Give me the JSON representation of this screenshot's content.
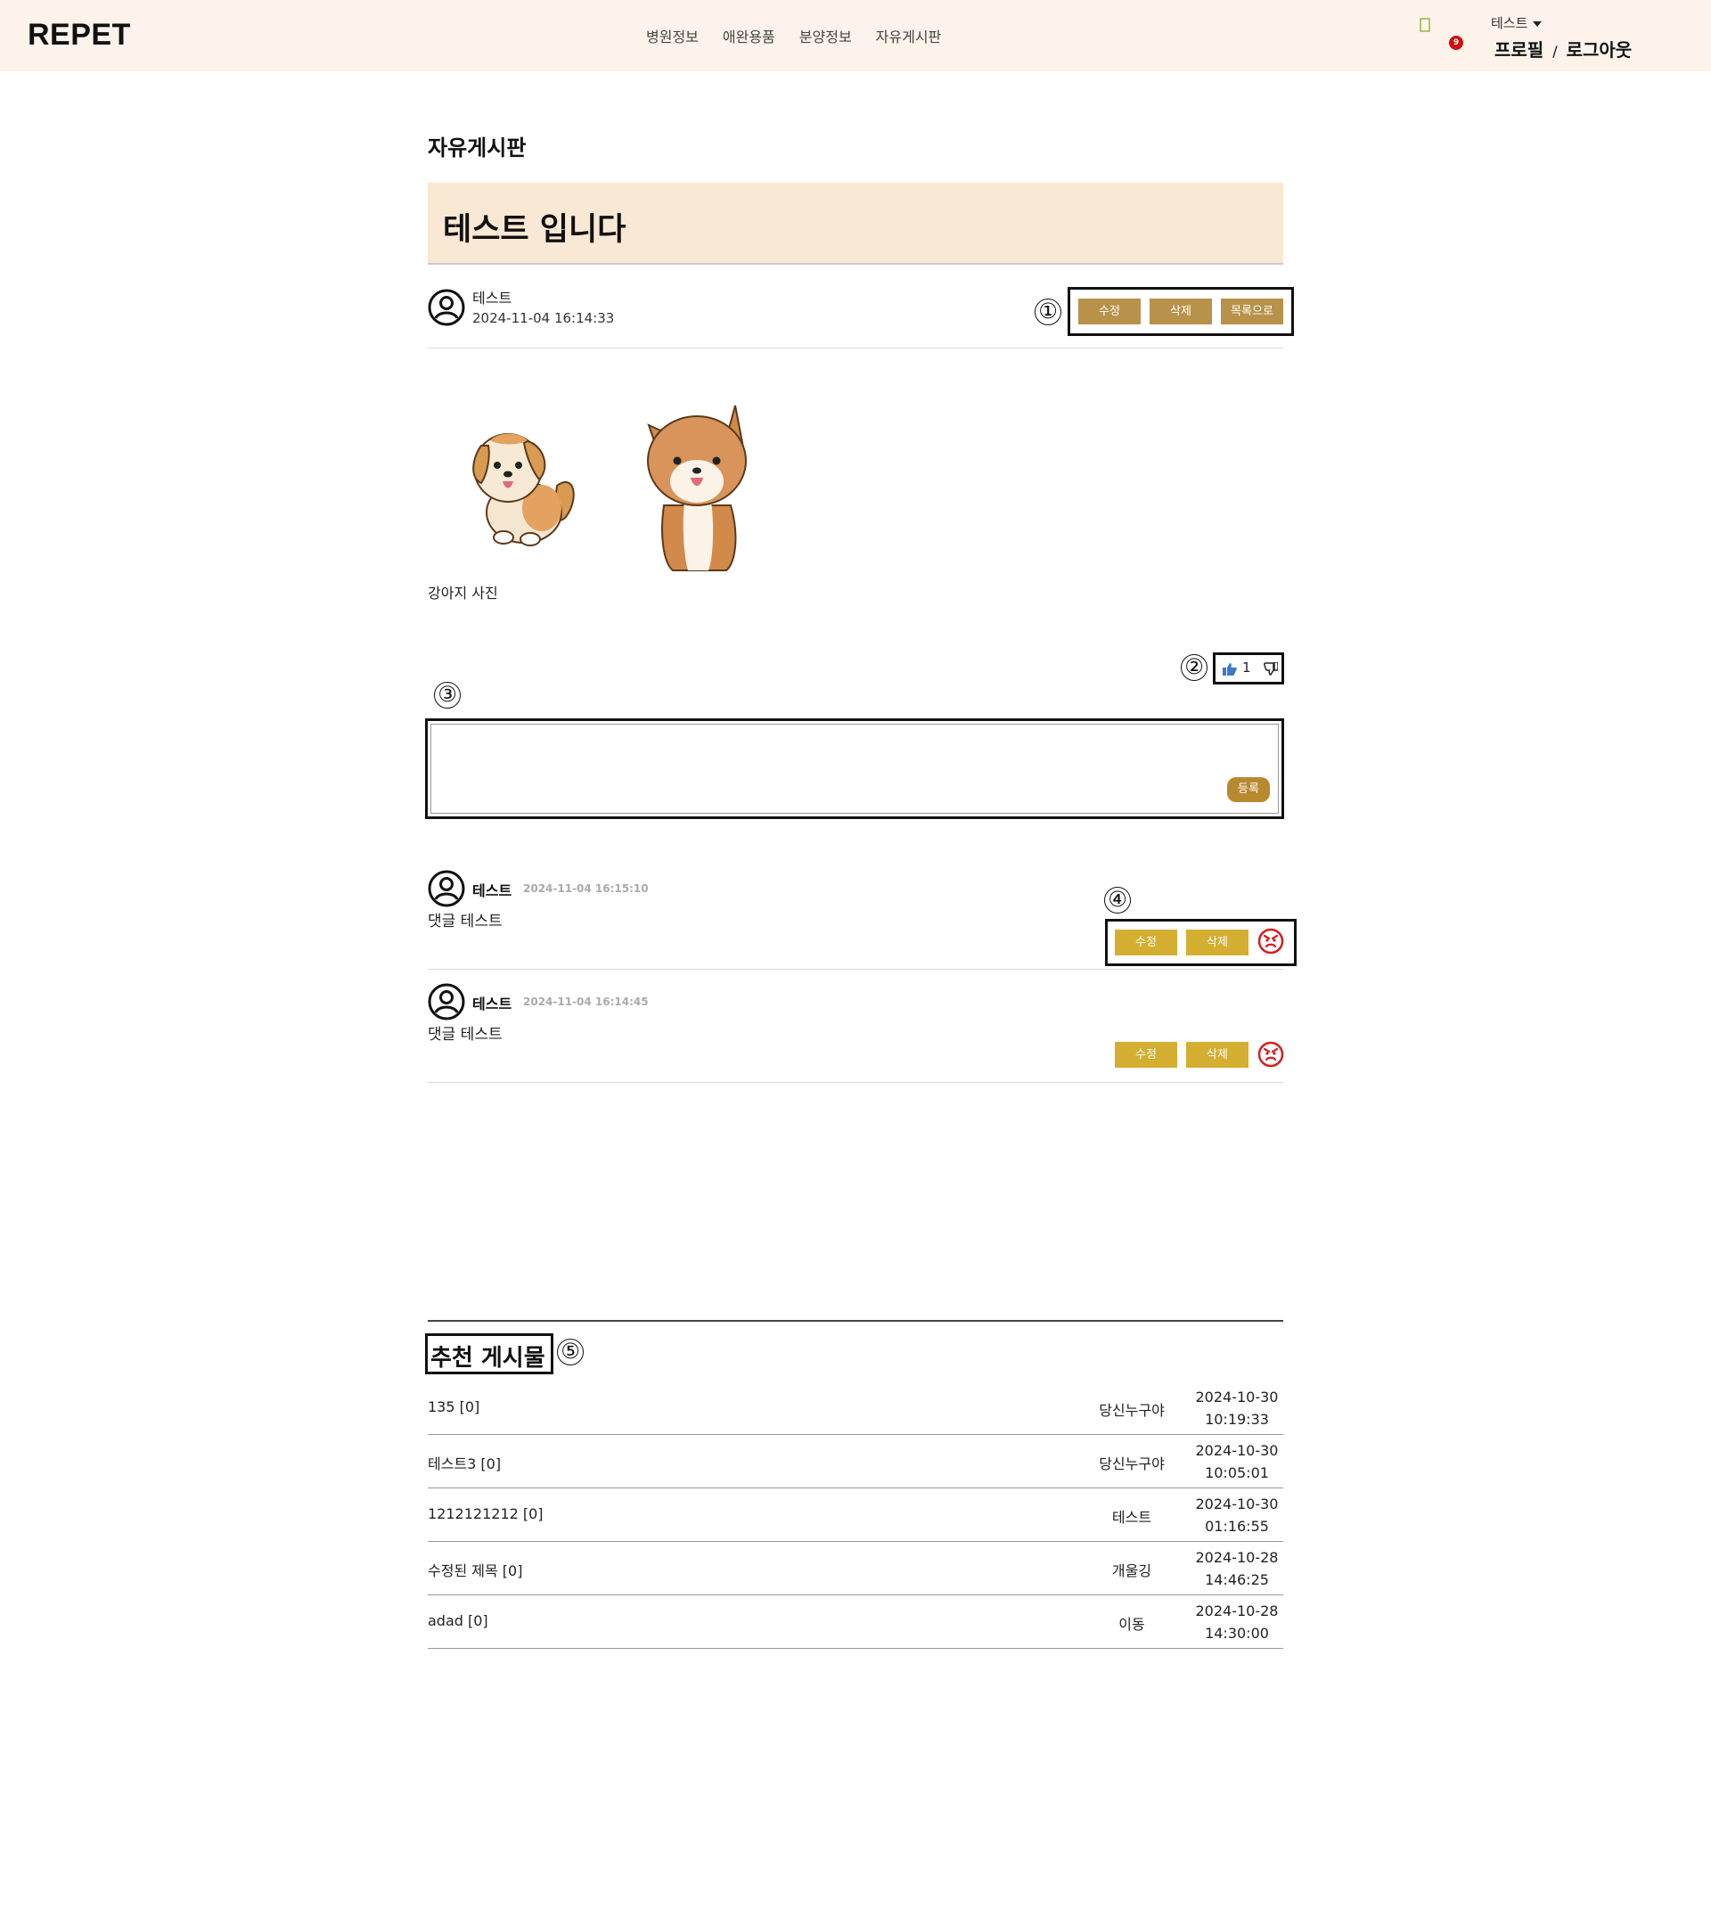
{
  "header": {
    "logo": "REPET",
    "nav": [
      "병원정보",
      "애완용품",
      "분양정보",
      "자유게시판"
    ],
    "notification_count": "9",
    "user_name": "테스트",
    "profile_link": "프로필",
    "separator": "/",
    "logout_link": "로그아웃"
  },
  "board": {
    "title": "자유게시판"
  },
  "post": {
    "title": "테스트 입니다",
    "author": "테스트",
    "date": "2024-11-04 16:14:33",
    "buttons": {
      "edit": "수정",
      "delete": "삭제",
      "list": "목록으로"
    },
    "image_caption": "강아지 사진",
    "like_count": "1"
  },
  "comment_form": {
    "submit": "등록"
  },
  "comments": [
    {
      "author": "테스트",
      "date": "2024-11-04 16:15:10",
      "body": "댓글 테스트",
      "edit": "수정",
      "delete": "삭제"
    },
    {
      "author": "테스트",
      "date": "2024-11-04 16:14:45",
      "body": "댓글 테스트",
      "edit": "수정",
      "delete": "삭제"
    }
  ],
  "recommended": {
    "title": "추천 게시물",
    "rows": [
      {
        "title": "135 [0]",
        "author": "당신누구야",
        "date": "2024-10-30",
        "time": "10:19:33"
      },
      {
        "title": "테스트3 [0]",
        "author": "당신누구야",
        "date": "2024-10-30",
        "time": "10:05:01"
      },
      {
        "title": "1212121212 [0]",
        "author": "테스트",
        "date": "2024-10-30",
        "time": "01:16:55"
      },
      {
        "title": "수정된 제목 [0]",
        "author": "개울깅",
        "date": "2024-10-28",
        "time": "14:46:25"
      },
      {
        "title": "adad [0]",
        "author": "이동",
        "date": "2024-10-28",
        "time": "14:30:00"
      }
    ]
  },
  "annotations": [
    "①",
    "②",
    "③",
    "④",
    "⑤"
  ],
  "icons": {
    "avatar": "user-circle-icon",
    "like": "thumbs-up-icon",
    "dislike": "thumbs-down-icon",
    "report": "angry-face-icon",
    "notification": "bell-icon",
    "dropdown": "caret-down-icon"
  },
  "colors": {
    "header_bg": "#fdf3ea",
    "title_box_bg": "#f9e8d3",
    "post_button": "#b8924a",
    "comment_button": "#d4ae30",
    "submit_button": "#b8892e",
    "badge": "#cc1111",
    "angry_icon": "#d61f1f"
  }
}
